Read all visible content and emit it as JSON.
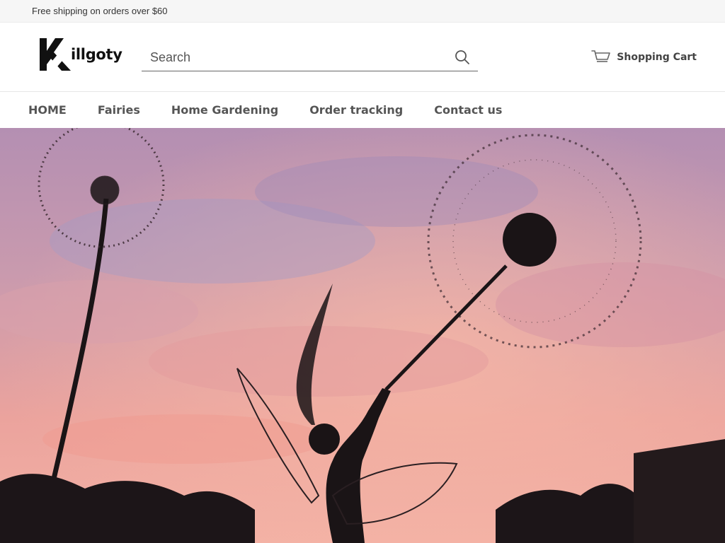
{
  "announcement": {
    "text": "Free shipping on orders over $60"
  },
  "brand": {
    "name": "illgoty",
    "initial": "K",
    "color": "#111111"
  },
  "search": {
    "placeholder": "Search",
    "value": "",
    "icon": "search-icon"
  },
  "cart": {
    "label": "Shopping Cart",
    "icon": "cart-icon"
  },
  "nav": {
    "items": [
      {
        "label": "HOME"
      },
      {
        "label": "Fairies"
      },
      {
        "label": "Home Gardening"
      },
      {
        "label": "Order tracking"
      },
      {
        "label": "Contact us"
      }
    ]
  },
  "colors": {
    "announcement_bg": "#f6f6f6",
    "nav_text": "#555555",
    "sky_top": "#b98fb3",
    "sky_bottom": "#f0a7a0",
    "silhouette": "#1a1416"
  }
}
